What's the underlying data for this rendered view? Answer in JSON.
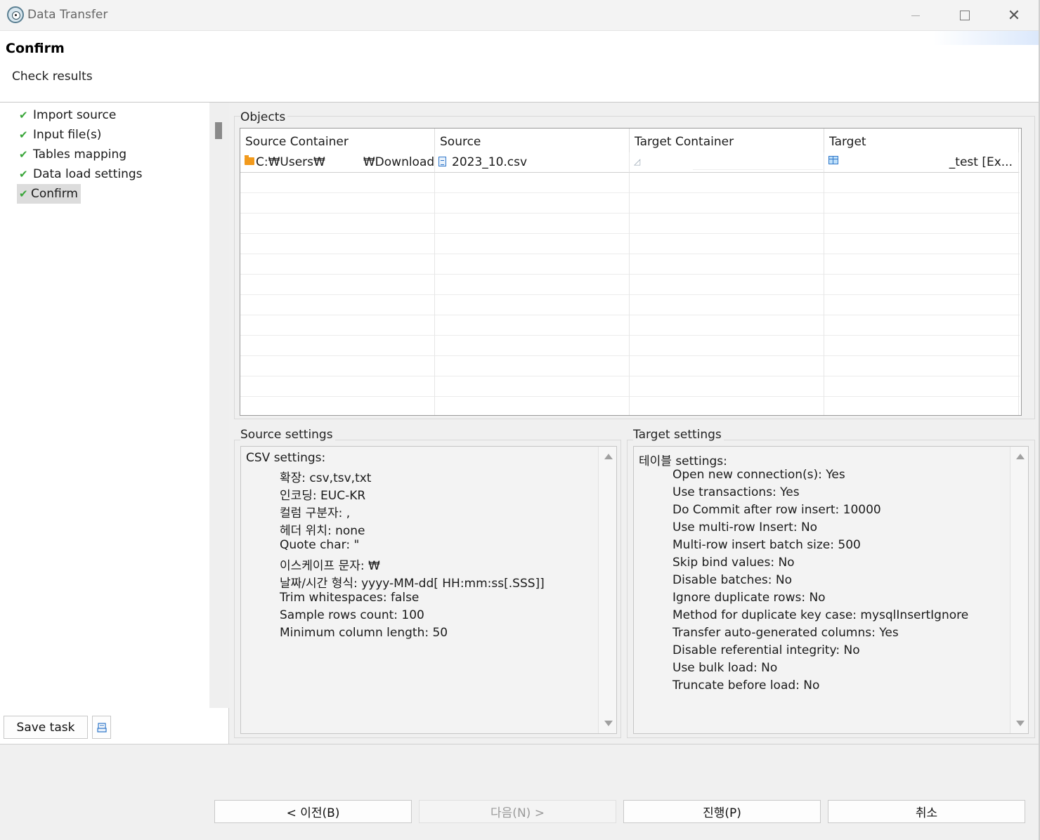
{
  "window": {
    "title": "Data Transfer"
  },
  "header": {
    "title": "Confirm",
    "description": "Check results"
  },
  "steps": [
    {
      "label": "Import source"
    },
    {
      "label": "Input file(s)"
    },
    {
      "label": "Tables mapping"
    },
    {
      "label": "Data load settings"
    },
    {
      "label": "Confirm"
    }
  ],
  "left_buttons": {
    "save_task": "Save task"
  },
  "objects": {
    "group_label": "Objects",
    "columns": [
      "Source Container",
      "Source",
      "Target Container",
      "Target"
    ],
    "rows": [
      {
        "source_container": "C:₩Users₩          ₩Downloads",
        "source": "2023_10.csv",
        "target_container": "",
        "target": "_test [Ex..."
      }
    ]
  },
  "source_settings": {
    "group_label": "Source settings",
    "heading": "CSV settings:",
    "lines": [
      "확장: csv,tsv,txt",
      "인코딩: EUC-KR",
      "컬럼 구분자: ,",
      "헤더 위치: none",
      "Quote char: \"",
      "이스케이프 문자: ₩",
      "날짜/시간 형식: yyyy-MM-dd[ HH:mm:ss[.SSS]]",
      "Trim whitespaces: false",
      "Sample rows count: 100",
      "Minimum column length: 50"
    ]
  },
  "target_settings": {
    "group_label": "Target settings",
    "heading": "테이블 settings:",
    "lines": [
      "Open new connection(s): Yes",
      "Use transactions: Yes",
      "Do Commit after row insert: 10000",
      "Use multi-row Insert: No",
      "Multi-row insert batch size: 500",
      "Skip bind values: No",
      "Disable batches: No",
      "Ignore duplicate rows: No",
      "Method for duplicate key case: mysqlInsertIgnore",
      "Transfer auto-generated columns: Yes",
      "Disable referential integrity: No",
      "Use bulk load: No",
      "Truncate before load: No"
    ]
  },
  "footer": {
    "back": "< 이전(B)",
    "next": "다음(N) >",
    "proceed": "진행(P)",
    "cancel": "취소"
  },
  "colors": {
    "check": "#3aa63a",
    "folder": "#f29a1c",
    "file": "#2e76c9",
    "accent_glow": "#dbe8fb"
  },
  "icons": {
    "app": "dbeaver-icon",
    "check": "check-icon",
    "folder": "folder-icon",
    "file": "csv-file-icon",
    "connection": "connection-icon",
    "table": "table-icon",
    "save": "save-icon"
  }
}
